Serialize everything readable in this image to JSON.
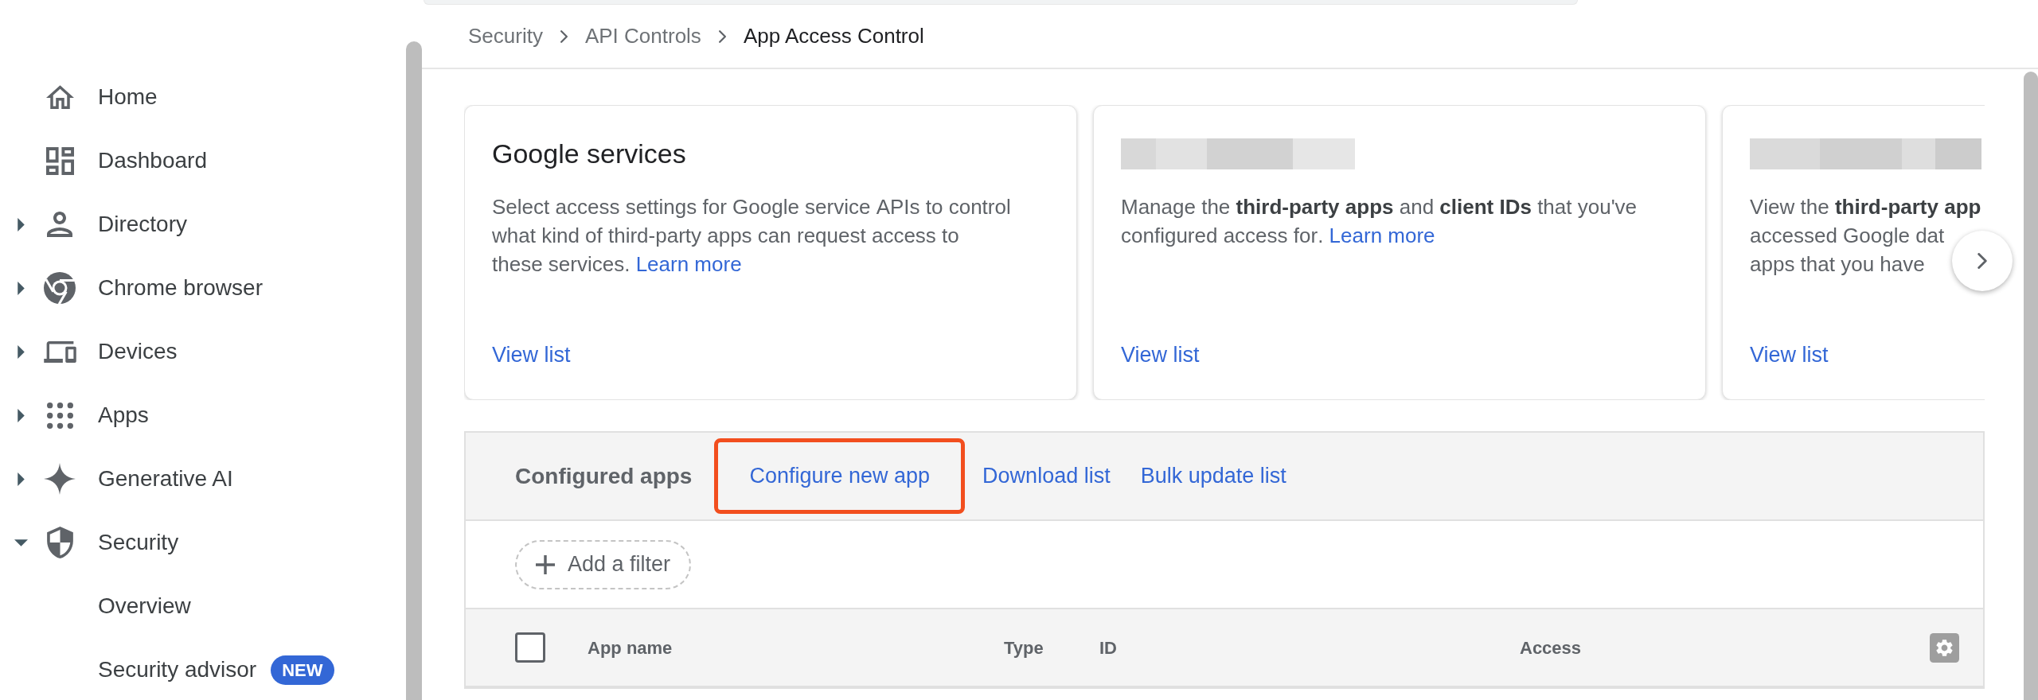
{
  "sidebar": {
    "items": [
      {
        "label": "Home"
      },
      {
        "label": "Dashboard"
      },
      {
        "label": "Directory",
        "expanded": false
      },
      {
        "label": "Chrome browser",
        "expanded": false
      },
      {
        "label": "Devices",
        "expanded": false
      },
      {
        "label": "Apps",
        "expanded": false
      },
      {
        "label": "Generative AI",
        "expanded": false
      },
      {
        "label": "Security",
        "expanded": true,
        "children": [
          {
            "label": "Overview"
          },
          {
            "label": "Security advisor",
            "badge": "NEW"
          }
        ]
      }
    ]
  },
  "breadcrumb": [
    {
      "label": "Security",
      "current": false
    },
    {
      "label": "API Controls",
      "current": false
    },
    {
      "label": "App Access Control",
      "current": true
    }
  ],
  "cards": [
    {
      "kind": "titled",
      "title": "Google services",
      "description": "Select access settings for Google service APIs to control what kind of third-party apps can request access to these services.",
      "link": "Learn more",
      "action": "View list"
    },
    {
      "kind": "redacted",
      "description": "Manage the **third-party apps** and **client IDs** that you've configured access for.",
      "link": "Learn more",
      "action": "View list"
    },
    {
      "kind": "redacted",
      "description_lines": [
        "View the **third-party app**",
        "accessed Google dat",
        "apps that you have"
      ],
      "action": "View list"
    }
  ],
  "configured_apps": {
    "title": "Configured apps",
    "actions": [
      {
        "label": "Configure new app",
        "highlighted": true
      },
      {
        "label": "Download list",
        "highlighted": false
      },
      {
        "label": "Bulk update list",
        "highlighted": false
      }
    ],
    "filter": {
      "label": "Add a filter"
    },
    "table": {
      "select_all": {
        "checked": false
      },
      "columns": [
        "App name",
        "Type",
        "ID",
        "Access"
      ]
    }
  }
}
